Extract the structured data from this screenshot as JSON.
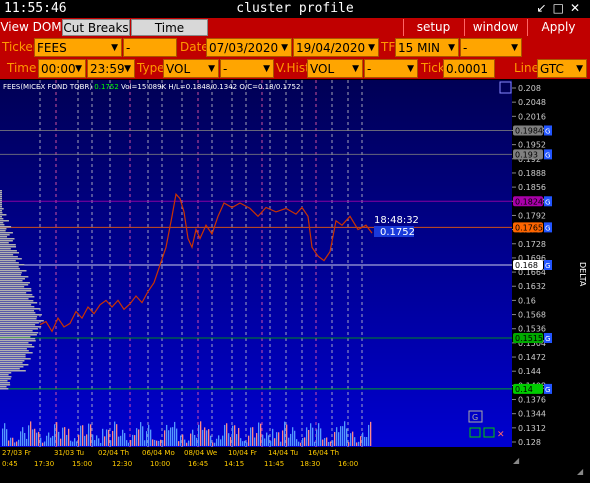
{
  "window": {
    "clock": "11:55:46",
    "title": "cluster profile"
  },
  "toolbar": {
    "view_dom": "View DOM",
    "cut_breaks": "Cut Breaks",
    "time_interval": "Time Interval",
    "setup": "setup",
    "window": "window",
    "apply": "Apply"
  },
  "params": {
    "ticker_label": "Ticker",
    "ticker": "FEES",
    "ticker2": "-",
    "date_label": "Date",
    "date_from": "07/03/2020",
    "date_to": "19/04/2020",
    "tf_label": "TF",
    "tf": "15 MIN",
    "tf2": "-",
    "time_label": "Time",
    "time_from": "00:00",
    "time_to": "23:59",
    "type_label": "Type",
    "type": "VOL",
    "type2": "-",
    "vhist_label": "V.Hist",
    "vhist": "VOL",
    "vhist2": "-",
    "tick_label": "Tick",
    "tick": "0.0001",
    "line_label": "Line",
    "line": "GTC"
  },
  "chart_info": {
    "symbol": "FEES(MICEX FOND TQBR)",
    "last": "0.1752",
    "stats": "Vol=15'089K  H/L=0.1848/0.1342  O/C=0.18/0.1752"
  },
  "current": {
    "time": "18:48:32",
    "price": "0.1752"
  },
  "price_axis": {
    "labels": [
      "0.208",
      "0.2048",
      "0.2016",
      "0.1984",
      "0.1952",
      "0.192",
      "0.1888",
      "0.1856",
      "0.1824",
      "0.1792",
      "0.176",
      "0.1728",
      "0.1696",
      "0.1664",
      "0.1632",
      "0.16",
      "0.1568",
      "0.1536",
      "0.1504",
      "0.1472",
      "0.144",
      "0.1408",
      "0.1376",
      "0.1344",
      "0.1312",
      "0.128"
    ],
    "delta_label": "DELTA"
  },
  "level_marks": [
    {
      "price": "0.1984",
      "color": "#808080",
      "tag": "G"
    },
    {
      "price": "0.193",
      "color": "#808080",
      "tag": "G"
    },
    {
      "price": "0.1824",
      "color": "#aa00aa",
      "tag": "G"
    },
    {
      "price": "0.1765",
      "color": "#ff6600",
      "tag": "G"
    },
    {
      "price": "0.168",
      "color": "#ffffff",
      "tag": "G"
    },
    {
      "price": "0.1515",
      "color": "#00aa00",
      "tag": "G"
    },
    {
      "price": "0.14",
      "color": "#00cc00",
      "tag": "G"
    }
  ],
  "time_axis": {
    "dates": [
      "27/03 Fr",
      "31/03 Tu",
      "02/04 Th",
      "06/04 Mo",
      "08/04 We",
      "10/04 Fr",
      "14/04 Tu",
      "16/04 Th"
    ],
    "times": [
      "0:45",
      "17:30",
      "15:00",
      "12:30",
      "10:00",
      "16:45",
      "14:15",
      "11:45",
      "18:30",
      "16:00"
    ]
  },
  "colors": {
    "bg_top": "#000066",
    "bg_bottom": "#0000cc",
    "panel": "#c00000",
    "field": "#ffa500"
  }
}
